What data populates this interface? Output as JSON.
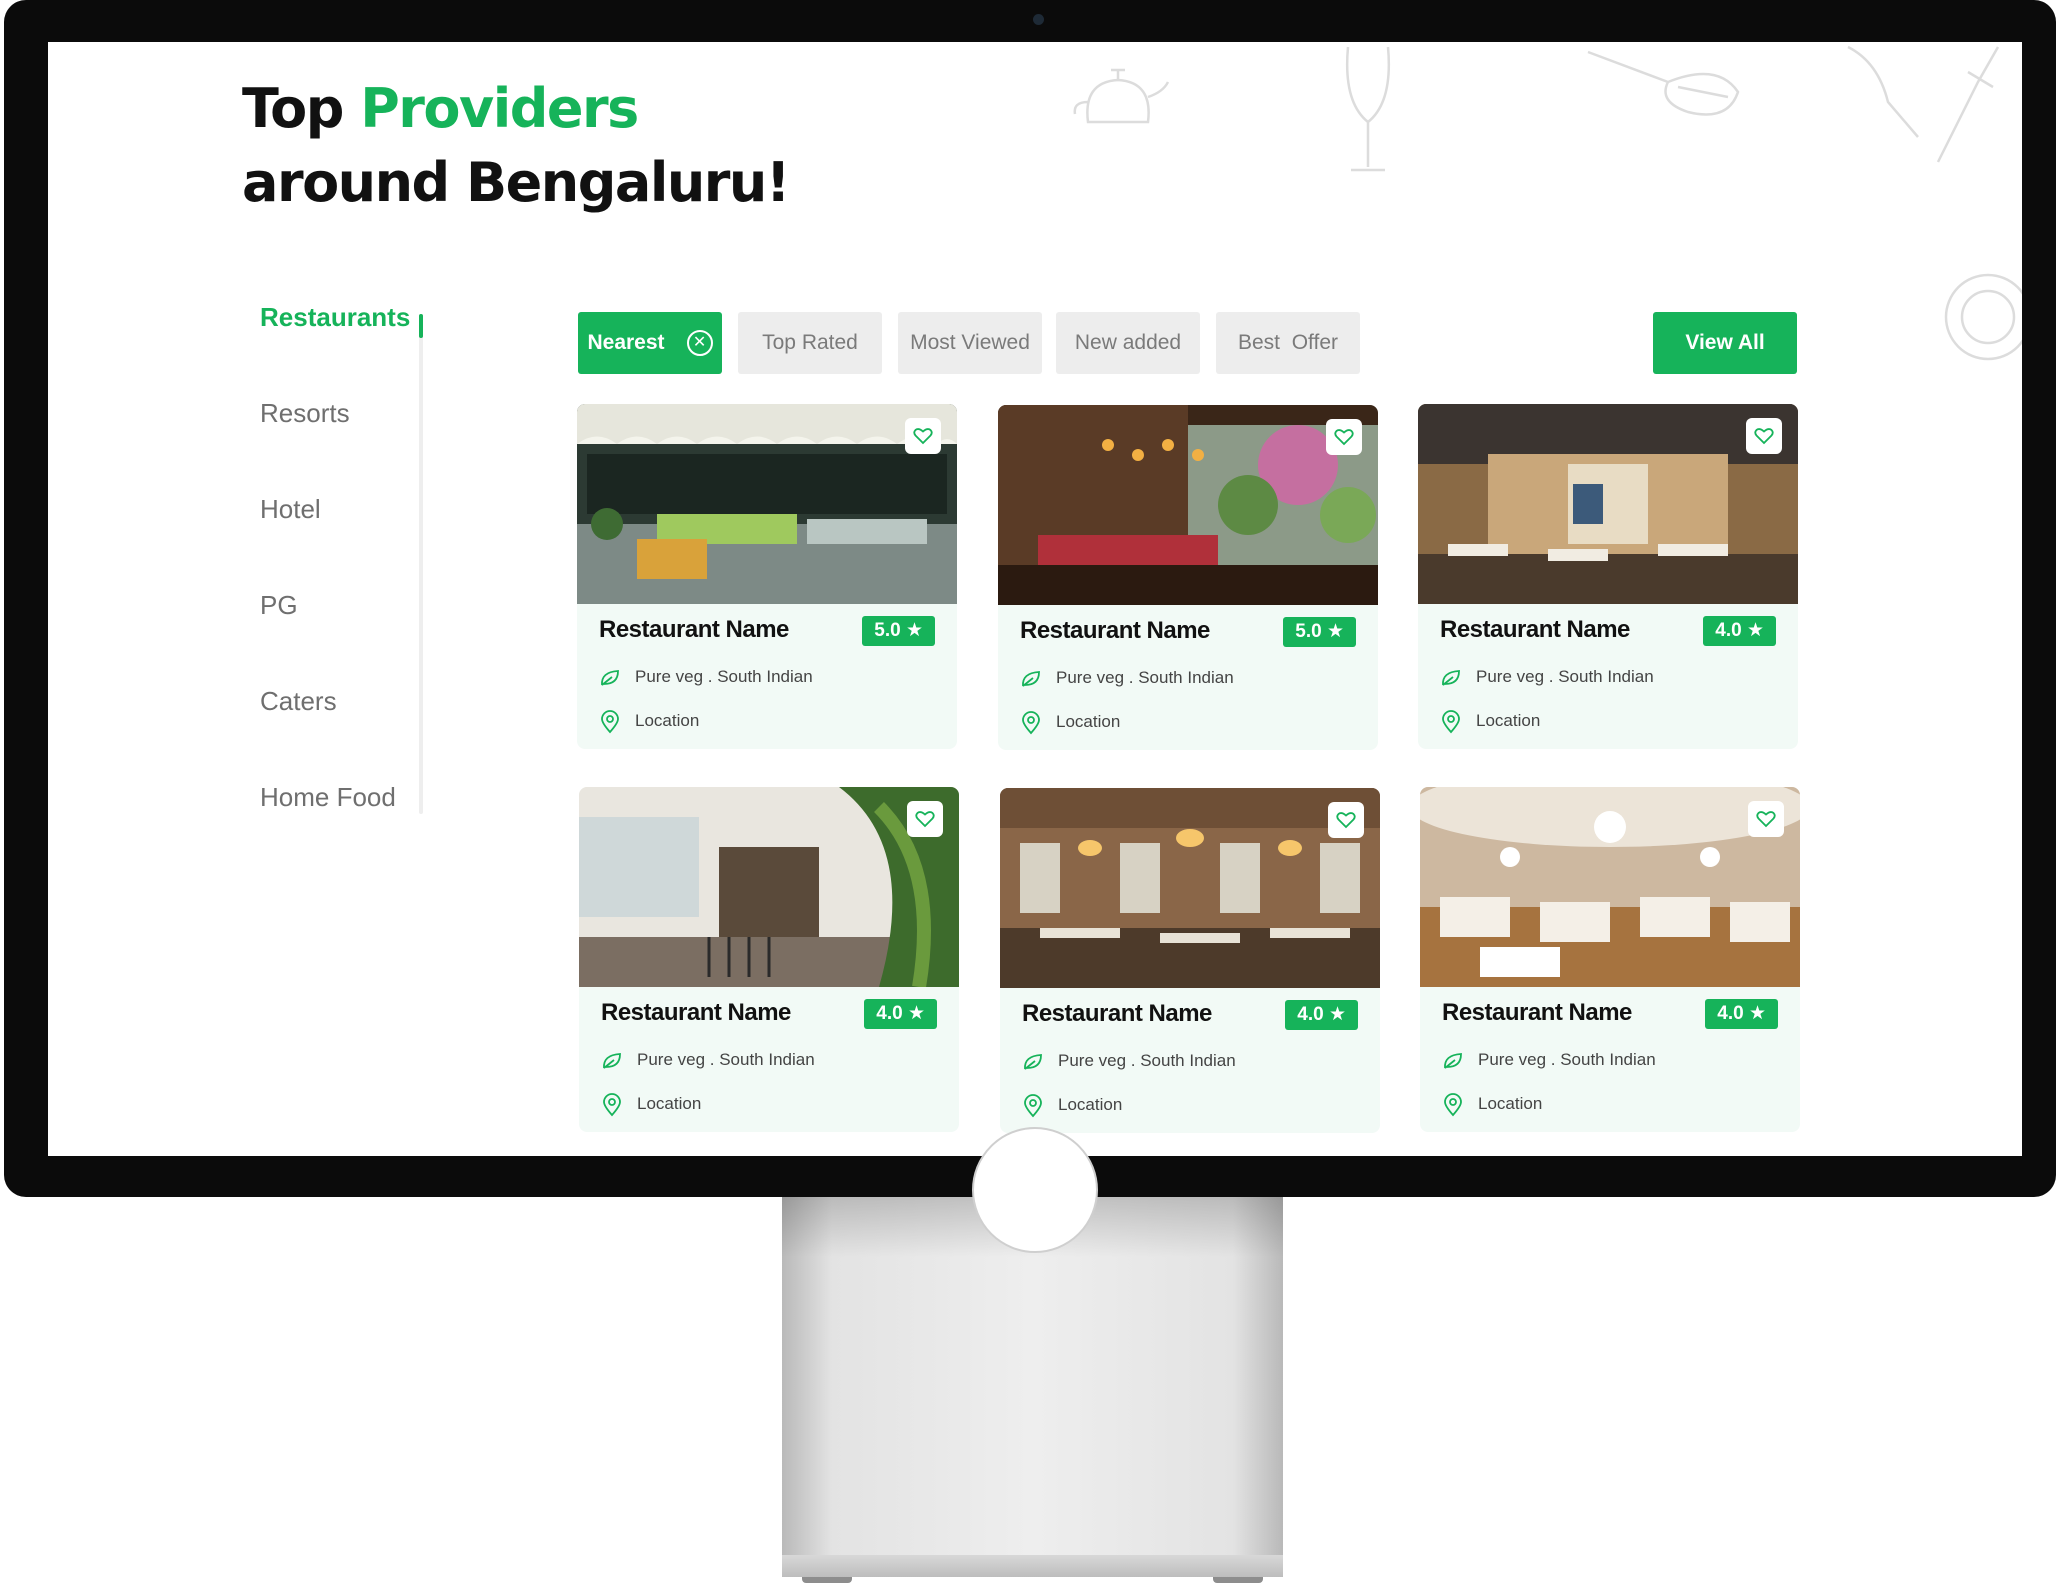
{
  "header": {
    "title_part1": "Top ",
    "title_accent": "Providers",
    "title_line2": "around Bengaluru!"
  },
  "sidebar": {
    "items": [
      {
        "label": "Restaurants",
        "active": true
      },
      {
        "label": "Resorts",
        "active": false
      },
      {
        "label": "Hotel",
        "active": false
      },
      {
        "label": "PG",
        "active": false
      },
      {
        "label": "Caters",
        "active": false
      },
      {
        "label": "Home Food",
        "active": false
      }
    ]
  },
  "filters": {
    "chips": [
      {
        "label": "Nearest",
        "active": true
      },
      {
        "label": "Top Rated",
        "active": false
      },
      {
        "label": "Most Viewed",
        "active": false
      },
      {
        "label": "New added",
        "active": false
      },
      {
        "label": "Best  Offer",
        "active": false
      }
    ],
    "view_all_label": "View All"
  },
  "cards": [
    {
      "name": "Restaurant Name",
      "rating": "5.0",
      "cuisine": "Pure veg . South Indian",
      "location": "Location"
    },
    {
      "name": "Restaurant Name",
      "rating": "5.0",
      "cuisine": "Pure veg . South Indian",
      "location": "Location"
    },
    {
      "name": "Restaurant Name",
      "rating": "4.0",
      "cuisine": "Pure veg . South Indian",
      "location": "Location"
    },
    {
      "name": "Restaurant Name",
      "rating": "4.0",
      "cuisine": "Pure veg . South Indian",
      "location": "Location"
    },
    {
      "name": "Restaurant Name",
      "rating": "4.0",
      "cuisine": "Pure veg . South Indian",
      "location": "Location"
    },
    {
      "name": "Restaurant Name",
      "rating": "4.0",
      "cuisine": "Pure veg . South Indian",
      "location": "Location"
    }
  ],
  "colors": {
    "accent": "#16b35a",
    "card_bg": "#f2faf6",
    "chip_bg": "#ededed"
  },
  "icons": {
    "close": "close-circle-icon",
    "favorite": "heart-icon",
    "star": "star-icon",
    "cuisine": "leaf-icon",
    "location": "map-pin-icon"
  }
}
